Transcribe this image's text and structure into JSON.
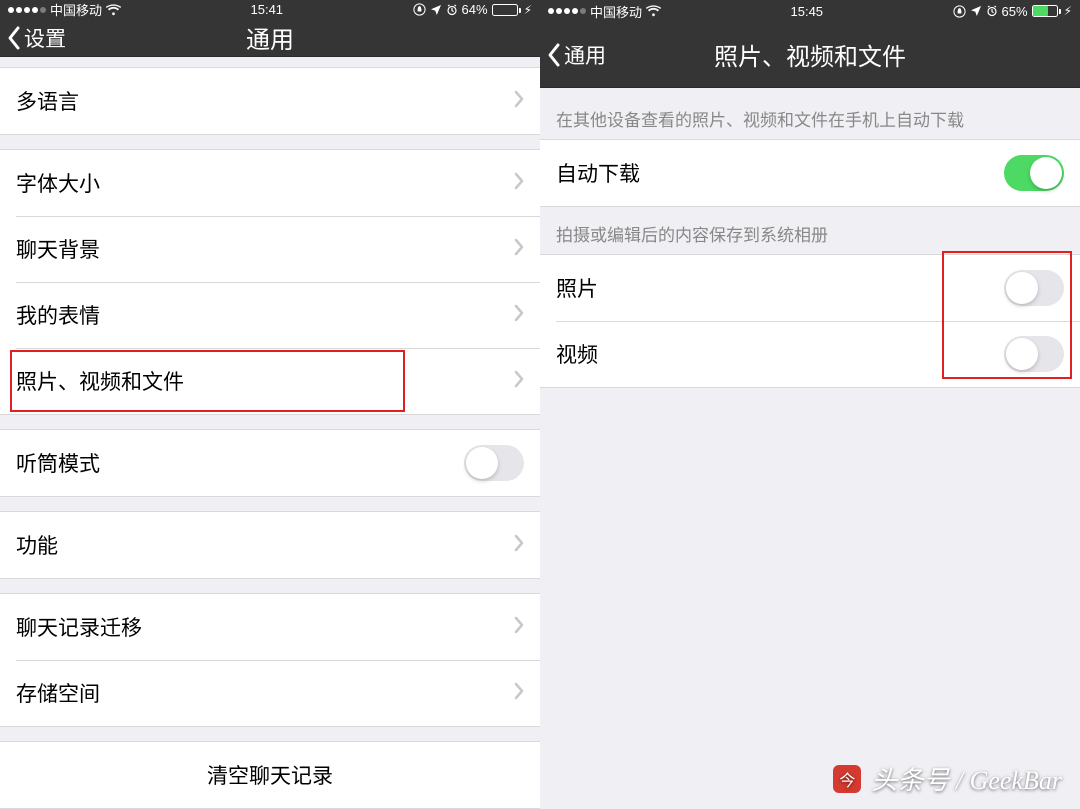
{
  "left": {
    "status": {
      "carrier": "中国移动",
      "time": "15:41",
      "battery_pct": "64%",
      "battery_fill": "64%"
    },
    "nav": {
      "back": "设置",
      "title": "通用"
    },
    "sections": [
      {
        "rows": [
          {
            "label": "多语言"
          }
        ]
      },
      {
        "rows": [
          {
            "label": "字体大小"
          },
          {
            "label": "聊天背景"
          },
          {
            "label": "我的表情"
          },
          {
            "label": "照片、视频和文件",
            "highlight": true
          }
        ]
      },
      {
        "rows": [
          {
            "label": "听筒模式",
            "switch": false
          }
        ]
      },
      {
        "rows": [
          {
            "label": "功能"
          }
        ]
      },
      {
        "rows": [
          {
            "label": "聊天记录迁移"
          },
          {
            "label": "存储空间"
          }
        ]
      },
      {
        "rows": [
          {
            "label": "清空聊天记录",
            "centered": true
          }
        ]
      }
    ]
  },
  "right": {
    "status": {
      "carrier": "中国移动",
      "time": "15:45",
      "battery_pct": "65%",
      "battery_fill": "65%"
    },
    "nav": {
      "back": "通用",
      "title": "照片、视频和文件"
    },
    "sections": [
      {
        "header": "在其他设备查看的照片、视频和文件在手机上自动下载",
        "rows": [
          {
            "label": "自动下载",
            "switch": true
          }
        ]
      },
      {
        "header": "拍摄或编辑后的内容保存到系统相册",
        "rows": [
          {
            "label": "照片",
            "switch": false,
            "highlight_switch": true
          },
          {
            "label": "视频",
            "switch": false,
            "highlight_switch": true
          }
        ]
      }
    ]
  },
  "watermark": "头条号 / GeekBar"
}
